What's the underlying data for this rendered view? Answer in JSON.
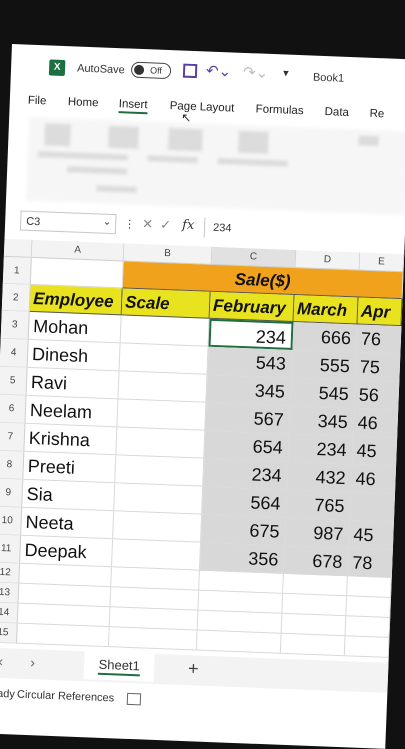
{
  "titlebar": {
    "autosave_label": "AutoSave",
    "autosave_state": "Off",
    "filename": "Book1"
  },
  "menu": {
    "items": [
      "File",
      "Home",
      "Insert",
      "Page Layout",
      "Formulas",
      "Data",
      "Re"
    ],
    "active": "Insert"
  },
  "formula_bar": {
    "name_box": "C3",
    "fx_symbol": "fx",
    "value": "234"
  },
  "grid": {
    "columns": [
      "A",
      "B",
      "C",
      "D",
      "E"
    ],
    "rows": [
      "1",
      "2",
      "3",
      "4",
      "5",
      "6",
      "7",
      "8",
      "9",
      "10",
      "11",
      "12",
      "13",
      "14",
      "15"
    ],
    "title_cell": "Sale($)",
    "headers": {
      "employee": "Employee",
      "scale": "Scale",
      "february": "February",
      "march": "March",
      "april": "Apr"
    },
    "employees": [
      "Mohan",
      "Dinesh",
      "Ravi",
      "Neelam",
      "Krishna",
      "Preeti",
      "Sia",
      "Neeta",
      "Deepak"
    ],
    "february": [
      "234",
      "543",
      "345",
      "567",
      "654",
      "234",
      "564",
      "675",
      "356"
    ],
    "march": [
      "666",
      "555",
      "545",
      "345",
      "234",
      "432",
      "765",
      "987",
      "678"
    ],
    "april": [
      "76",
      "75",
      "56",
      "46",
      "45",
      "46",
      "",
      "45",
      "78"
    ]
  },
  "sheets": {
    "tabs": [
      "Sheet1"
    ],
    "add_label": "+"
  },
  "status": {
    "ready": "Ready",
    "circular": "Circular References"
  },
  "colors": {
    "header_yellow": "#e9e21e",
    "title_orange": "#f0a21c",
    "selection_grey": "#d8d8d8",
    "excel_green": "#1d6f42"
  }
}
